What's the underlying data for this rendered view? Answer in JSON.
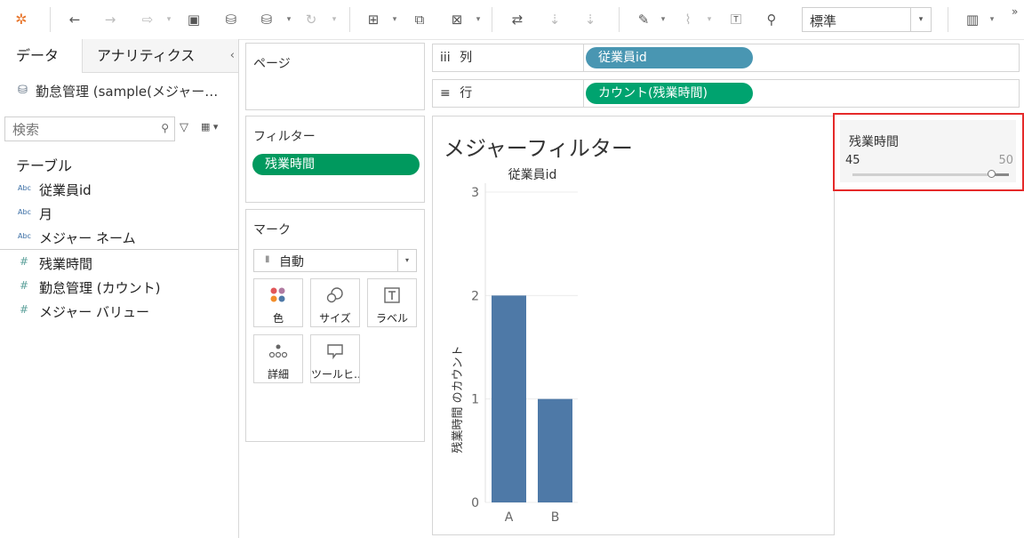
{
  "toolbar": {
    "icons": [
      "tableau-logo-icon",
      "undo-icon",
      "redo-icon",
      "replay-icon",
      "save-icon",
      "new-datasource-icon",
      "pause-updates-icon",
      "refresh-icon",
      "new-worksheet-icon",
      "duplicate-sheet-icon",
      "clear-sheet-icon",
      "swap-icon",
      "sort-ascending-icon",
      "sort-descending-icon",
      "highlight-icon",
      "group-icon",
      "show-labels-icon",
      "pin-icon",
      "show-me-icon"
    ],
    "fit_value": "標準",
    "overflow": "»"
  },
  "data_pane": {
    "tab_data": "データ",
    "tab_analytics": "アナリティクス",
    "collapse": "‹",
    "datasource": "勤怠管理 (sample(メジャー…",
    "search_placeholder": "検索",
    "tables_heading": "テーブル",
    "dimensions": [
      {
        "type": "Abc",
        "name": "従業員id"
      },
      {
        "type": "Abc",
        "name": "月"
      },
      {
        "type": "Abc",
        "name": "メジャー ネーム"
      }
    ],
    "measures": [
      {
        "type": "#",
        "name": "残業時間"
      },
      {
        "type": "#",
        "name": "勤怠管理 (カウント)"
      },
      {
        "type": "#",
        "name": "メジャー バリュー"
      }
    ]
  },
  "pages_card": {
    "title": "ページ"
  },
  "filters_card": {
    "title": "フィルター",
    "pill": "残業時間"
  },
  "marks_card": {
    "title": "マーク",
    "mark_type": "自動",
    "buttons": [
      {
        "icon": "color-icon",
        "label": "色"
      },
      {
        "icon": "size-icon",
        "label": "サイズ"
      },
      {
        "icon": "label-icon",
        "label": "ラベル"
      },
      {
        "icon": "detail-icon",
        "label": "詳細"
      },
      {
        "icon": "tooltip-icon",
        "label": "ツールヒ…"
      }
    ]
  },
  "shelves": {
    "columns_label": "列",
    "columns_icon": "iii",
    "columns_pill": "従業員id",
    "rows_label": "行",
    "rows_icon": "≡",
    "rows_pill": "カウント(残業時間)"
  },
  "colors": {
    "dimension_pill": "#4996b2",
    "measure_pill": "#00a36f",
    "filter_pill": "#00995e",
    "bar": "#4e79a7",
    "highlight_border": "#e52a2a"
  },
  "sheet": {
    "title": "メジャーフィルター"
  },
  "chart_data": {
    "type": "bar",
    "column_header": "従業員id",
    "categories": [
      "A",
      "B"
    ],
    "values": [
      2,
      1
    ],
    "ylabel": "残業時間 のカウント",
    "ylim": [
      0,
      3
    ],
    "yticks": [
      "0",
      "1",
      "2",
      "3"
    ],
    "grid": true
  },
  "range_filter": {
    "title": "残業時間",
    "min_label": "45",
    "max_label": "50",
    "range_min": 45,
    "range_max": 50,
    "selected_min": 50,
    "selected_max": 50
  }
}
